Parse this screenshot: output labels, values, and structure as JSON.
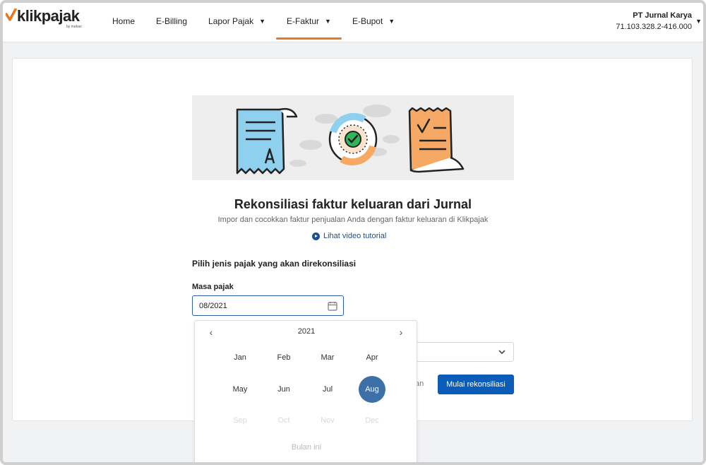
{
  "brand": {
    "name": "klikpajak",
    "tagline": "by mekari",
    "accent": "#e87722"
  },
  "nav": {
    "items": [
      {
        "label": "Home",
        "dropdown": false
      },
      {
        "label": "E-Billing",
        "dropdown": false
      },
      {
        "label": "Lapor Pajak",
        "dropdown": true
      },
      {
        "label": "E-Faktur",
        "dropdown": true,
        "active": true
      },
      {
        "label": "E-Bupot",
        "dropdown": true
      }
    ]
  },
  "company": {
    "name": "PT Jurnal Karya",
    "npwp": "71.103.328.2-416.000"
  },
  "main": {
    "title": "Rekonsiliasi faktur keluaran dari Jurnal",
    "subtitle": "Impor dan cocokkan faktur penjualan Anda dengan faktur keluaran di Klikpajak",
    "video_link": "Lihat video tutorial",
    "section_title": "Pilih jenis pajak yang akan direkonsiliasi",
    "masa_label": "Masa pajak",
    "masa_value": "08/2021",
    "select_partial": "n",
    "cancel_partial": "an",
    "primary_button": "Mulai rekonsiliasi"
  },
  "picker": {
    "year": "2021",
    "months": [
      "Jan",
      "Feb",
      "Mar",
      "Apr",
      "May",
      "Jun",
      "Jul",
      "Aug",
      "Sep",
      "Oct",
      "Nov",
      "Dec"
    ],
    "selected": "Aug",
    "disabled": [
      "Sep",
      "Oct",
      "Nov",
      "Dec"
    ],
    "this_month": "Bulan ini"
  },
  "colors": {
    "primary": "#0b5cb8",
    "selected_month": "#3d6fa8",
    "link": "#1f4e8c"
  }
}
